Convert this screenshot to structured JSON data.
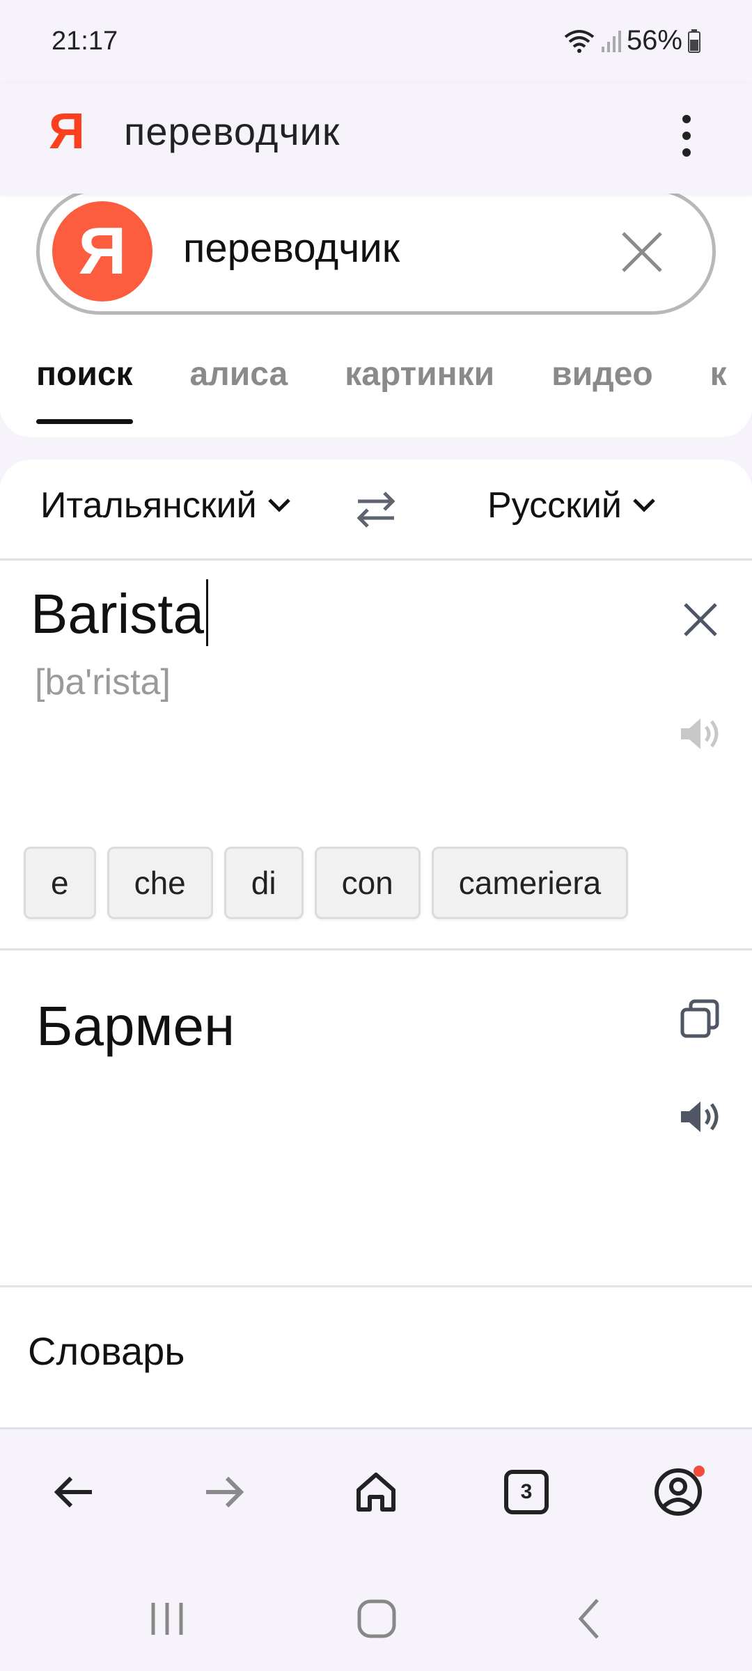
{
  "status_bar": {
    "time": "21:17",
    "battery": "56%"
  },
  "header": {
    "logo": "Я",
    "query": "переводчик"
  },
  "search": {
    "logo": "Я",
    "value": "переводчик",
    "tabs": [
      {
        "label": "поиск",
        "active": true
      },
      {
        "label": "алиса",
        "active": false
      },
      {
        "label": "картинки",
        "active": false
      },
      {
        "label": "видео",
        "active": false
      },
      {
        "label": "к",
        "active": false
      }
    ]
  },
  "translator": {
    "source_lang": "Итальянский",
    "target_lang": "Русский",
    "source_text": "Barista",
    "transcription": "[ba'rista]",
    "suggestions": [
      "e",
      "che",
      "di",
      "con",
      "cameriera"
    ],
    "result_text": "Бармен",
    "dictionary_label": "Словарь"
  },
  "bottom_bar": {
    "tab_count": "3"
  },
  "colors": {
    "accent": "#fc3f1d",
    "logo_circle": "#fc5d3e",
    "notification": "#f24b3c"
  },
  "icons": [
    "wifi-icon",
    "signal-icon",
    "battery-icon",
    "more-vert-icon",
    "close-icon",
    "swap-icon",
    "chevron-down-icon",
    "speaker-icon",
    "copy-icon",
    "back-arrow-icon",
    "forward-arrow-icon",
    "home-icon",
    "tabs-icon",
    "profile-icon",
    "recents-icon",
    "home-circle-icon",
    "back-chevron-icon"
  ]
}
